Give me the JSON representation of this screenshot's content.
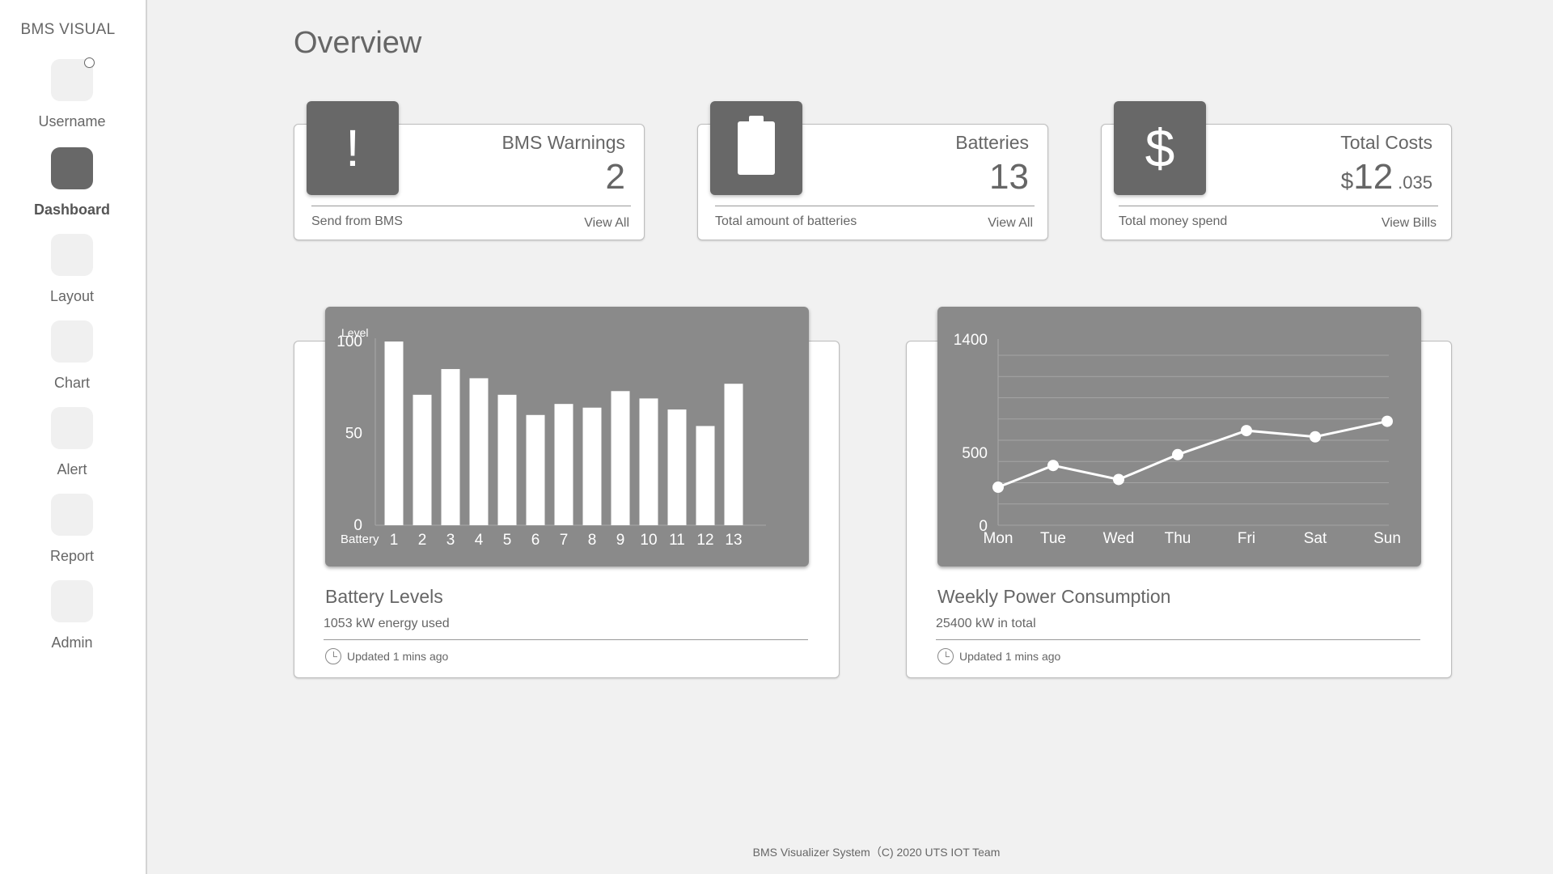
{
  "app": {
    "brand": "BMS VISUAL"
  },
  "sidebar": {
    "items": [
      {
        "label": "Username",
        "active": false
      },
      {
        "label": "Dashboard",
        "active": true
      },
      {
        "label": "Layout",
        "active": false
      },
      {
        "label": "Chart",
        "active": false
      },
      {
        "label": "Alert",
        "active": false
      },
      {
        "label": "Report",
        "active": false
      },
      {
        "label": "Admin",
        "active": false
      }
    ]
  },
  "page": {
    "title": "Overview"
  },
  "stats": {
    "warnings": {
      "icon": "exclamation-icon",
      "title": "BMS Warnings",
      "value": "2",
      "sub": "Send from BMS",
      "link": "View All"
    },
    "batteries": {
      "icon": "battery-icon",
      "title": "Batteries",
      "value": "13",
      "sub": "Total amount of batteries",
      "link": "View All"
    },
    "costs": {
      "icon": "dollar-icon",
      "title": "Total Costs",
      "currency": "$",
      "value_main": "12",
      "value_frac": ".035",
      "sub": "Total money spend",
      "link": "View Bills"
    }
  },
  "battery_card": {
    "title": "Battery Levels",
    "sub": "1053 kW energy used",
    "updated": "Updated 1 mins ago"
  },
  "power_card": {
    "title": "Weekly Power Consumption",
    "sub": "25400 kW in total",
    "updated": "Updated 1 mins ago"
  },
  "chart_data": [
    {
      "type": "bar",
      "ylabel": "Level",
      "xlabel": "Battery",
      "categories": [
        "1",
        "2",
        "3",
        "4",
        "5",
        "6",
        "7",
        "8",
        "9",
        "10",
        "11",
        "12",
        "13"
      ],
      "values": [
        100,
        71,
        85,
        80,
        71,
        60,
        66,
        64,
        73,
        69,
        63,
        54,
        77
      ],
      "ylim": [
        0,
        100
      ],
      "yticks": [
        "0",
        "50",
        "100"
      ],
      "colors": {
        "panel": "#8a8a8a",
        "bar": "#ffffff"
      }
    },
    {
      "type": "line",
      "categories": [
        "Mon",
        "Tue",
        "Wed",
        "Thu",
        "Fri",
        "Sat",
        "Sun"
      ],
      "values": [
        245,
        385,
        295,
        455,
        610,
        570,
        670
      ],
      "ylim": [
        0,
        1200
      ],
      "yticks": [
        "0",
        "500",
        "1400"
      ],
      "grid": true,
      "colors": {
        "panel": "#8a8a8a",
        "line": "#ffffff",
        "grid": "#a4a4a4"
      }
    }
  ],
  "footer": {
    "text": "BMS Visualizer System（C) 2020 UTS IOT Team"
  }
}
